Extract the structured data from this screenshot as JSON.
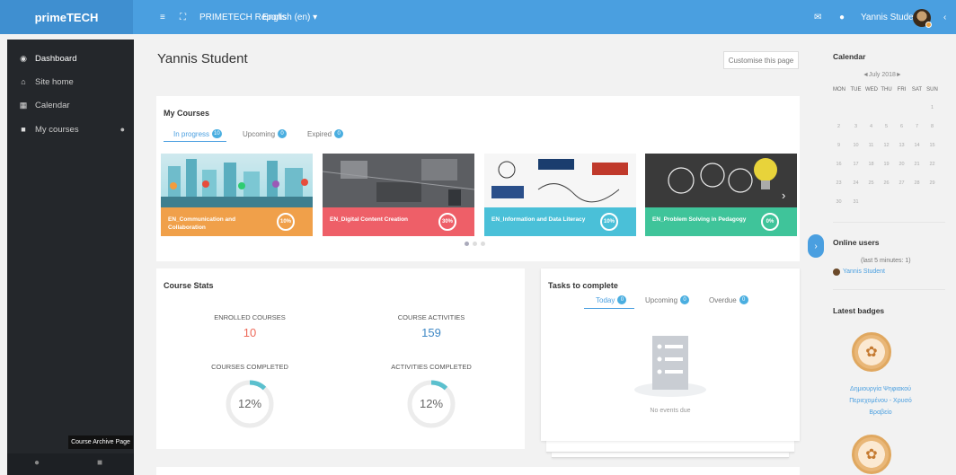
{
  "topbar": {
    "brand": "primeTECH",
    "reports": "PRIMETECH Reports",
    "language": "English (en) ▾",
    "user_name": "Yannis Student"
  },
  "sidebar": {
    "items": [
      {
        "label": "Dashboard",
        "icon": "dashboard-icon"
      },
      {
        "label": "Site home",
        "icon": "home-icon"
      },
      {
        "label": "Calendar",
        "icon": "calendar-icon"
      },
      {
        "label": "My courses",
        "icon": "graduation-cap-icon"
      }
    ],
    "tooltip": "Course Archive Page"
  },
  "page": {
    "title": "Yannis Student",
    "customise_button": "Customise this page"
  },
  "my_courses": {
    "title": "My Courses",
    "tabs": [
      {
        "label": "In progress",
        "count": "10"
      },
      {
        "label": "Upcoming",
        "count": "0"
      },
      {
        "label": "Expired",
        "count": "0"
      }
    ],
    "courses": [
      {
        "name": "EN_Communication and Collaboration",
        "progress": "10%",
        "color": "#f0a04a"
      },
      {
        "name": "EN_Digital Content Creation",
        "progress": "30%",
        "color": "#ee5f68"
      },
      {
        "name": "EN_Information and Data Literacy",
        "progress": "10%",
        "color": "#4ac0d8"
      },
      {
        "name": "EN_Problem Solving in Pedagogy",
        "progress": "0%",
        "color": "#3fc49a"
      }
    ]
  },
  "course_stats": {
    "title": "Course Stats",
    "enrolled_label": "ENROLLED COURSES",
    "enrolled_value": "10",
    "activities_label": "COURSE ACTIVITIES",
    "activities_value": "159",
    "completed_label": "COURSES COMPLETED",
    "completed_value": "12%",
    "completed_fraction": 0.12,
    "act_completed_label": "ACTIVITIES COMPLETED",
    "act_completed_value": "12%",
    "act_completed_fraction": 0.12
  },
  "tasks": {
    "title": "Tasks to complete",
    "tabs": [
      {
        "label": "Today",
        "count": "0"
      },
      {
        "label": "Upcoming",
        "count": "0"
      },
      {
        "label": "Overdue",
        "count": "0"
      }
    ],
    "empty": "No events due"
  },
  "calendar": {
    "title": "Calendar",
    "month": "◄July 2018►",
    "days": [
      "MON",
      "TUE",
      "WED",
      "THU",
      "FRI",
      "SAT",
      "SUN"
    ],
    "weeks": [
      [
        "",
        "",
        "",
        "",
        "",
        "",
        "1"
      ],
      [
        "2",
        "3",
        "4",
        "5",
        "6",
        "7",
        "8"
      ],
      [
        "9",
        "10",
        "11",
        "12",
        "13",
        "14",
        "15"
      ],
      [
        "16",
        "17",
        "18",
        "19",
        "20",
        "21",
        "22"
      ],
      [
        "23",
        "24",
        "25",
        "26",
        "27",
        "28",
        "29"
      ],
      [
        "30",
        "31",
        "",
        "",
        "",
        "",
        ""
      ]
    ]
  },
  "online_users": {
    "title": "Online users",
    "subtitle": "(last 5 minutes: 1)",
    "user": "Yannis Student"
  },
  "latest_badges": {
    "title": "Latest badges",
    "badge_name": "Δημιουργία Ψηφιακού Περιεχομένου - Χρυσό Βραβείο"
  },
  "colors": {
    "topbar": "#4a9fe0",
    "sidebar": "#24272b",
    "accent": "#4a9fe0",
    "enrolled": "#ee6a5a",
    "activities": "#3f88c5"
  }
}
